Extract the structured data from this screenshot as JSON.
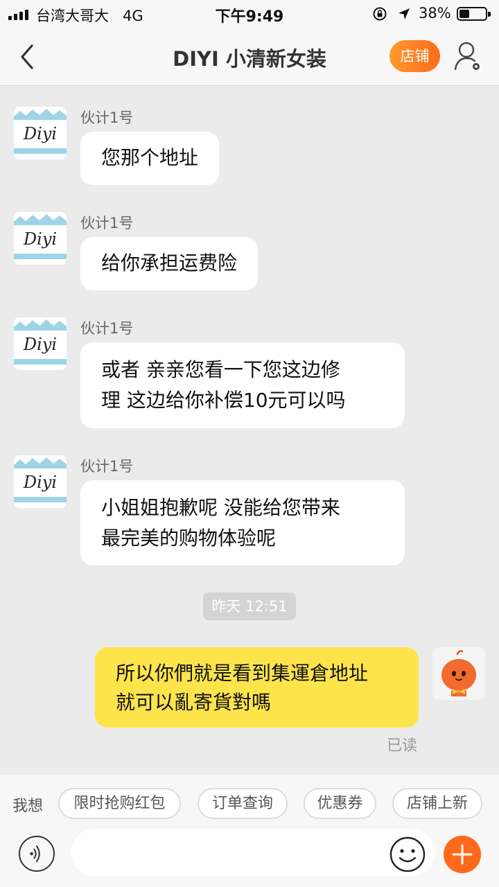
{
  "status_bar": {
    "carrier": "台湾大哥大",
    "network": "4G",
    "time": "下午9:49",
    "battery": "38%"
  },
  "header": {
    "title": "DIYI 小清新女装",
    "shop_button": "店铺"
  },
  "conversation": {
    "messages": [
      {
        "sender": "伙计1号",
        "text": "您那个地址"
      },
      {
        "sender": "伙计1号",
        "text": "给你承担运费险"
      },
      {
        "sender": "伙计1号",
        "text": "或者 亲亲您看一下您这边修\n理  这边给你补偿10元可以吗"
      },
      {
        "sender": "伙计1号",
        "text": "小姐姐抱歉呢  没能给您带来\n最完美的购物体验呢"
      }
    ],
    "timestamp": "昨天 12:51",
    "my_message": {
      "text": "所以你們就是看到集運倉地址\n就可以亂寄貨對嗎",
      "status": "已读"
    }
  },
  "avatar_logo": "Diyi",
  "quick_replies": {
    "label": "我想",
    "chips": [
      "限时抢购红包",
      "订单查询",
      "优惠券",
      "店铺上新"
    ]
  },
  "input": {
    "placeholder": ""
  },
  "colors": {
    "accent": "#ff6a1a",
    "my_bubble": "#fde44b",
    "background": "#ebebeb"
  }
}
